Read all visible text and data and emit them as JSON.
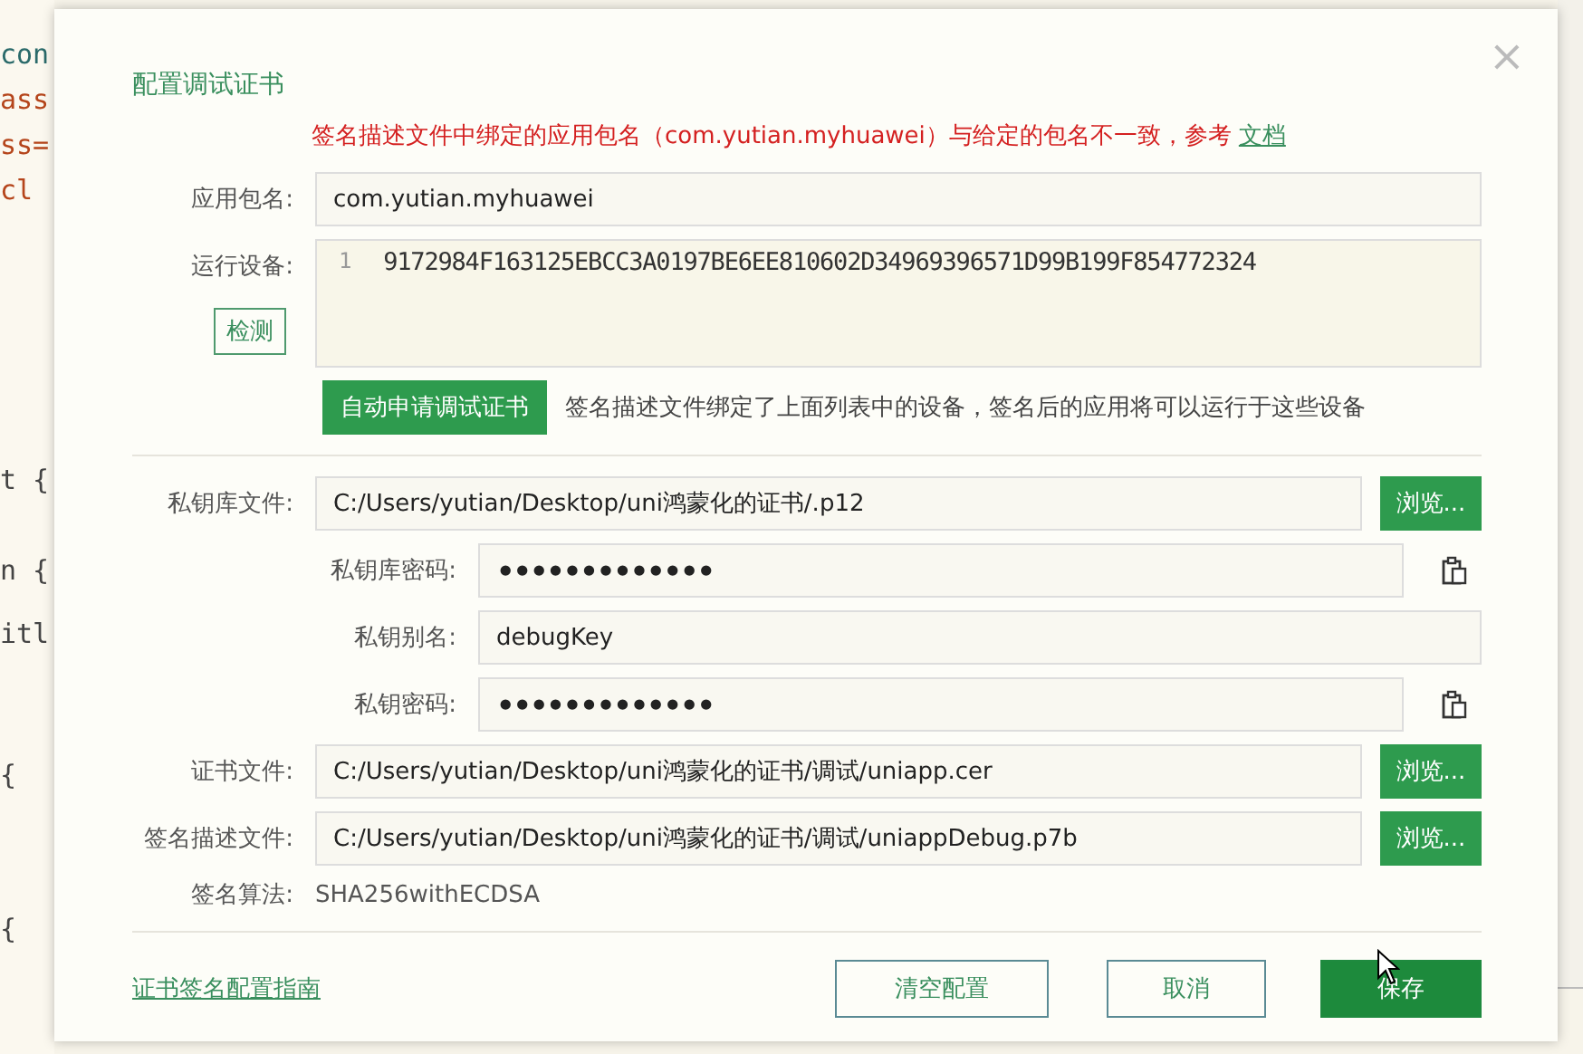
{
  "editor": {
    "lines": [
      {
        "text": "con",
        "kind": "tag"
      },
      {
        "text": "ass",
        "kind": "attr"
      },
      {
        "text": "ss=",
        "kind": "attr"
      },
      {
        "text": "cl",
        "kind": "attr"
      },
      {
        "text": "t {",
        "kind": "plain"
      },
      {
        "text": "n {",
        "kind": "plain"
      },
      {
        "text": "itl",
        "kind": "plain"
      },
      {
        "text": "{",
        "kind": "plain"
      },
      {
        "text": "{",
        "kind": "plain"
      }
    ]
  },
  "dialog": {
    "title": "配置调试证书",
    "close": "×",
    "warning": {
      "text": "签名描述文件中绑定的应用包名（com.yutian.myhuawei）与给定的包名不一致，参考",
      "link": "文档"
    },
    "fields": [
      {
        "kind": "text",
        "label": "应用包名:",
        "value": "com.yutian.myhuawei"
      },
      {
        "kind": "lines",
        "label": "运行设备:",
        "lines": [
          {
            "number": "1",
            "text": "9172984F163125EBCC3A0197BE6EE810602D34969396571D99B199F854772324"
          }
        ],
        "button": "检测",
        "apply_button": "自动申请调试证书",
        "note": "签名描述文件绑定了上面列表中的设备，签名后的应用将可以运行于这些设备"
      },
      {
        "kind": "divider"
      },
      {
        "kind": "file",
        "label": "私钥库文件:",
        "value": "C:/Users/yutian/Desktop/uni鸿蒙化的证书/.p12",
        "button": "浏览...",
        "children": [
          {
            "kind": "password",
            "label": "私钥库密码:",
            "value": "•••••••••••••"
          },
          {
            "kind": "text",
            "label": "私钥别名:",
            "value": "debugKey"
          },
          {
            "kind": "password",
            "label": "私钥密码:",
            "value": "•••••••••••••"
          }
        ]
      },
      {
        "kind": "file",
        "label": "证书文件:",
        "value": "C:/Users/yutian/Desktop/uni鸿蒙化的证书/调试/uniapp.cer",
        "button": "浏览..."
      },
      {
        "kind": "file",
        "label": "签名描述文件:",
        "value": "C:/Users/yutian/Desktop/uni鸿蒙化的证书/调试/uniappDebug.p7b",
        "button": "浏览..."
      },
      {
        "kind": "static",
        "label": "签名算法:",
        "value": "SHA256withECDSA"
      },
      {
        "kind": "divider"
      }
    ],
    "guide_link": "证书签名配置指南",
    "buttons": [
      {
        "label": "清空配置",
        "primary": false
      },
      {
        "label": "取消",
        "primary": false
      },
      {
        "label": "保存",
        "primary": true
      }
    ]
  }
}
